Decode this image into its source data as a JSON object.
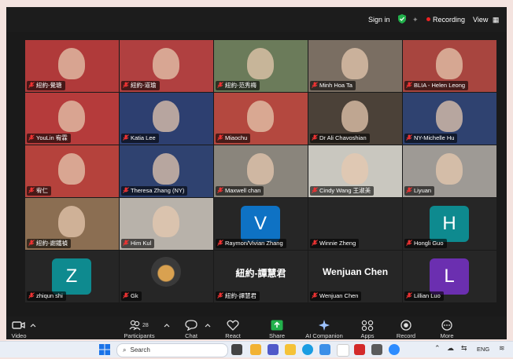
{
  "topbar": {
    "sign_in": "Sign in",
    "recording": "Recording",
    "view": "View"
  },
  "participants": [
    {
      "name": "紐約-覺瑭",
      "bg": "#b03a3a"
    },
    {
      "name": "紐約-道瑜",
      "bg": "#b04040"
    },
    {
      "name": "紐約-范秀梅",
      "bg": "#6b7b5a"
    },
    {
      "name": "Minh Hoa Ta",
      "bg": "#7a6e62"
    },
    {
      "name": "BLIA - Helen Leong",
      "bg": "#a8453f"
    },
    {
      "name": "YouLin 宥霖",
      "bg": "#b53b3b"
    },
    {
      "name": "Katia Lee",
      "bg": "#2d3f70"
    },
    {
      "name": "Miaochu",
      "bg": "#b4483f"
    },
    {
      "name": "Dr Ali Chavoshian",
      "bg": "#4b4138"
    },
    {
      "name": "NY-Michelle Hu",
      "bg": "#2f4270"
    },
    {
      "name": "宥仁",
      "bg": "#b5423c"
    },
    {
      "name": "Theresa Zhang (NY)",
      "bg": "#2f4270"
    },
    {
      "name": "Maxwell chan",
      "bg": "#8a857c"
    },
    {
      "name": "Cindy Wang 王淑美",
      "bg": "#c9c7bf"
    },
    {
      "name": "Liyuan",
      "bg": "#9e9a95"
    },
    {
      "name": "紐約-謝鐵禎",
      "bg": "#8b6e52"
    },
    {
      "name": "Him Kul",
      "bg": "#b8b2aa"
    },
    {
      "name": "Raymon/Vivian Zhang",
      "bg": "#262626",
      "letter": "V",
      "letter_color": "#0e72c4"
    },
    {
      "name": "Winnie Zheng",
      "bg": "#262626"
    },
    {
      "name": "Hongli Guo",
      "bg": "#262626",
      "letter": "H",
      "letter_color": "#0e8a8f"
    },
    {
      "name": "zhiqun shi",
      "bg": "#262626",
      "letter": "Z",
      "letter_color": "#0e8a8f"
    },
    {
      "name": "Gk",
      "bg": "#262626"
    },
    {
      "name": "紐約-譚慧君",
      "bg": "#262626",
      "big": "紐約-譚慧君"
    },
    {
      "name": "Wenjuan Chen",
      "bg": "#262626",
      "big": "Wenjuan Chen"
    },
    {
      "name": "Lillian Luo",
      "bg": "#262626",
      "letter": "L",
      "letter_color": "#6b2fb0"
    }
  ],
  "toolbar": {
    "video": "Video",
    "participants": "Participants",
    "participants_count": "28",
    "chat": "Chat",
    "react": "React",
    "share": "Share",
    "ai": "AI Companion",
    "apps": "Apps",
    "record": "Record",
    "more": "More"
  },
  "taskbar": {
    "search": "Search",
    "lang": "ENG"
  }
}
